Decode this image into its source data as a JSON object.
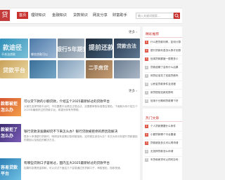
{
  "nav": {
    "logo": "贷",
    "items": [
      "首页",
      "理财知识",
      "金融知识",
      "贷款常识",
      "网友分享",
      "财富助手"
    ],
    "search_placeholder": "输入关键词搜索..."
  },
  "banner": {
    "more": "更多 ›",
    "tiles": [
      {
        "caption": "不合法贷款",
        "big": "款途径"
      },
      {
        "caption": "哪些贷款可以",
        "big": "银行5年期贷"
      },
      {
        "caption": "",
        "big": "提前还款"
      },
      {
        "caption": "",
        "big": "贷款合法"
      },
      {
        "caption": "",
        "big": "贷款平台"
      },
      {
        "caption": "",
        "big": ""
      },
      {
        "caption": "",
        "big": "二手房贷"
      },
      {
        "caption": "",
        "big": ""
      }
    ]
  },
  "articles": {
    "more": "更多 ›",
    "items": [
      {
        "title": "可以贷下款的小额贷款，介绍五个2025最新好过的贷款平台",
        "desc": "大家在选择贷款平台时，不仅要看平台是否正规合法，还要看审核标准是否宽松。下面就为你介绍五个2025年最新好过的贷款平台，希望对你有所帮助。",
        "thumb": [
          "款都被拒",
          "怎么办"
        ]
      },
      {
        "title": "银行贷款没逾期却贷不下来怎么办？银行贷款被拒绝的原因及解决",
        "desc": "很多人申请银行贷款时，明明没有逾期记录却被拒绝，这时候应该怎么办？本文为你分析银行贷款被拒的原因以及相应的解决方法。",
        "thumb": [
          "款被拒了",
          "怎么办"
        ]
      },
      {
        "title": "有哪些贷款口子容易过，国内五大2025最新好过的贷款平台",
        "desc": "如果你急需资金周转，可以试试下面这几个容易通过的贷款口子，审核宽松、放款快速。",
        "thumb": [
          "容易贷款",
          "平台"
        ]
      }
    ]
  },
  "sidebar": {
    "section1": "精彩推荐",
    "list1": [
      "什么是贷款利率，如何计算",
      "银行贷款利息怎么算才划算",
      "信用贷款额度一般是多少",
      "贷款逾期了会有什么后果",
      "网贷征信花了还能贷款吗",
      "公积金贷款条件及流程",
      "房贷提前还款划算吗",
      "信用卡分期和贷款哪个好"
    ],
    "section2": "热门文章",
    "list2": [
      "个人贷款需要什么条件",
      "小额贷款哪个平台靠谱",
      "贷款被拒多久可以再申请",
      "无抵押贷款怎么申请",
      "车贷和房贷可以同时办吗"
    ],
    "colors": {
      "accent": "#c8322f",
      "num_hot": "#e05a4a",
      "num_normal": "#c7c7c7"
    }
  }
}
